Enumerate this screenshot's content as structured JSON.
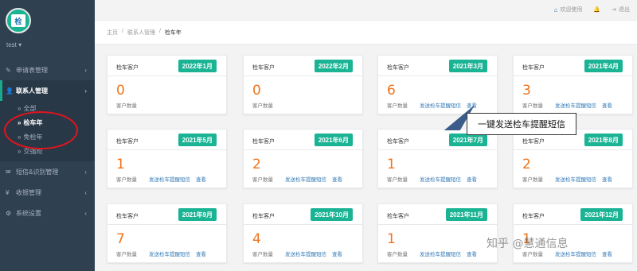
{
  "sidebar": {
    "logo_text": "检",
    "user_name": "test ▾",
    "menu": [
      {
        "icon": "✎",
        "label": "申请表管理",
        "chevron": "‹"
      },
      {
        "icon": "👤",
        "label": "联系人管理",
        "chevron": "›"
      },
      {
        "icon": "✉",
        "label": "短信&识别管理",
        "chevron": "‹"
      },
      {
        "icon": "¥",
        "label": "收银管理",
        "chevron": "‹"
      },
      {
        "icon": "⚙",
        "label": "系统设置",
        "chevron": "‹"
      }
    ],
    "submenu": [
      {
        "label": "全部"
      },
      {
        "label": "检车年"
      },
      {
        "label": "免检年"
      },
      {
        "label": "交强险"
      }
    ]
  },
  "topbar": {
    "welcome": "欢迎使用",
    "logout": "退出"
  },
  "breadcrumb": [
    "主页",
    "/",
    "联系人管理",
    "/",
    "检车年"
  ],
  "cards": [
    {
      "title": "检车客户",
      "badge": "2022年1月",
      "count": "0",
      "count_label": "客户数量",
      "send_link": "",
      "view_link": ""
    },
    {
      "title": "检车客户",
      "badge": "2022年2月",
      "count": "0",
      "count_label": "客户数量",
      "send_link": "",
      "view_link": ""
    },
    {
      "title": "检车客户",
      "badge": "2021年3月",
      "count": "6",
      "count_label": "客户数量",
      "send_link": "发送检车提醒短信",
      "view_link": "查看"
    },
    {
      "title": "检车客户",
      "badge": "2021年4月",
      "count": "3",
      "count_label": "客户数量",
      "send_link": "发送检车提醒短信",
      "view_link": "查看"
    },
    {
      "title": "检车客户",
      "badge": "2021年5月",
      "count": "1",
      "count_label": "客户数量",
      "send_link": "发送检车提醒短信",
      "view_link": "查看"
    },
    {
      "title": "检车客户",
      "badge": "2021年6月",
      "count": "2",
      "count_label": "客户数量",
      "send_link": "发送检车提醒短信",
      "view_link": "查看"
    },
    {
      "title": "检车客户",
      "badge": "2021年7月",
      "count": "1",
      "count_label": "客户数量",
      "send_link": "发送检车提醒短信",
      "view_link": "查看"
    },
    {
      "title": "检车客户",
      "badge": "2021年8月",
      "count": "2",
      "count_label": "客户数量",
      "send_link": "发送检车提醒短信",
      "view_link": "查看"
    },
    {
      "title": "检车客户",
      "badge": "2021年9月",
      "count": "7",
      "count_label": "客户数量",
      "send_link": "发送检车提醒短信",
      "view_link": "查看"
    },
    {
      "title": "检车客户",
      "badge": "2021年10月",
      "count": "4",
      "count_label": "客户数量",
      "send_link": "发送检车提醒短信",
      "view_link": "查看"
    },
    {
      "title": "检车客户",
      "badge": "2021年11月",
      "count": "1",
      "count_label": "客户数量",
      "send_link": "发送检车提醒短信",
      "view_link": "查看"
    },
    {
      "title": "检车客户",
      "badge": "2021年12月",
      "count": "1",
      "count_label": "客户数量",
      "send_link": "发送检车提醒短信",
      "view_link": "查看"
    }
  ],
  "callout": "一键发送检车提醒短信",
  "watermark": "知乎 @慧通信息",
  "colors": {
    "sidebar_bg": "#2f4050",
    "accent_green": "#1ab394",
    "count_orange": "#f0731a",
    "link_blue": "#337ab7",
    "highlight_red": "#e3141c"
  }
}
